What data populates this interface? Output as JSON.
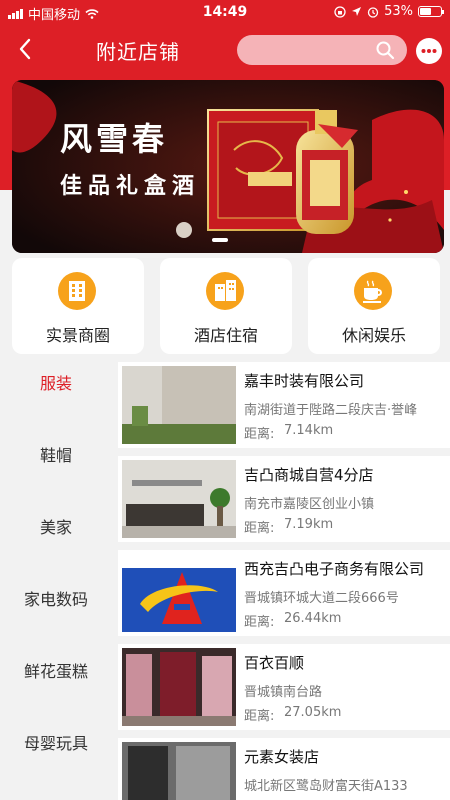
{
  "status_bar": {
    "carrier": "中国移动",
    "time": "14:49",
    "battery_percent": "53%",
    "battery_level": 0.53
  },
  "nav": {
    "title": "附近店铺",
    "search_placeholder": ""
  },
  "banner": {
    "slogan_line1": "风雪春",
    "slogan_line2": "佳品礼盒酒",
    "slide_count": 1
  },
  "categories": [
    {
      "label": "实景商圈",
      "icon": "building-icon"
    },
    {
      "label": "酒店住宿",
      "icon": "hotel-icon"
    },
    {
      "label": "休闲娱乐",
      "icon": "coffee-icon"
    }
  ],
  "sidebar": {
    "items": [
      {
        "label": "服装",
        "active": true
      },
      {
        "label": "鞋帽"
      },
      {
        "label": "美家"
      },
      {
        "label": "家电数码"
      },
      {
        "label": "鲜花蛋糕"
      },
      {
        "label": "母婴玩具"
      }
    ]
  },
  "stores": [
    {
      "name": "嘉丰时装有限公司",
      "address": "南湖街道于陛路二段庆吉·誉峰",
      "distance_label": "距离:",
      "distance": "7.14km"
    },
    {
      "name": "吉凸商城自营4分店",
      "address": "南充市嘉陵区创业小镇",
      "distance_label": "距离:",
      "distance": "7.19km"
    },
    {
      "name": "西充吉凸电子商务有限公司",
      "address": "晋城镇环城大道二段666号",
      "distance_label": "距离:",
      "distance": "26.44km"
    },
    {
      "name": "百衣百顺",
      "address": "晋城镇南台路",
      "distance_label": "距离:",
      "distance": "27.05km"
    },
    {
      "name": "元素女装店",
      "address": "城北新区鹭岛财富天街A133",
      "distance_label": "距离:",
      "distance": ""
    }
  ],
  "colors": {
    "brand_red": "#dd1f26",
    "icon_orange": "#f7a21b"
  }
}
